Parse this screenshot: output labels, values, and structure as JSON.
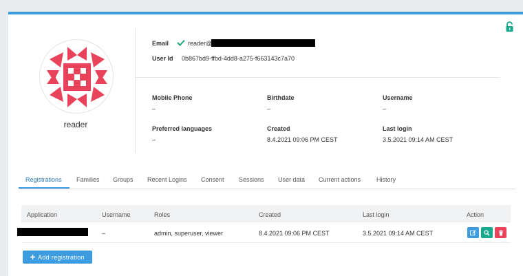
{
  "user": {
    "display_name": "reader",
    "email_label": "Email",
    "email_value": "reader@",
    "user_id_label": "User Id",
    "user_id_value": "0b867bd9-ffbd-4dd8-a275-f663143c7a70"
  },
  "details": [
    {
      "label": "Mobile Phone",
      "value": "–"
    },
    {
      "label": "Birthdate",
      "value": "–"
    },
    {
      "label": "Username",
      "value": "–"
    },
    {
      "label": "Preferred languages",
      "value": "–"
    },
    {
      "label": "Created",
      "value": "8.4.2021 09:06 PM CEST"
    },
    {
      "label": "Last login",
      "value": "3.5.2021 09:14 AM CEST"
    }
  ],
  "tabs": [
    "Registrations",
    "Families",
    "Groups",
    "Recent Logins",
    "Consent",
    "Sessions",
    "User data",
    "Current actions",
    "History"
  ],
  "active_tab": "Registrations",
  "table": {
    "headers": [
      "Application",
      "Username",
      "Roles",
      "Created",
      "Last login",
      "Action"
    ],
    "rows": [
      {
        "application": "",
        "username": "–",
        "roles": "admin, superuser, viewer",
        "created": "8.4.2021 09:06 PM CEST",
        "last_login": "3.5.2021 09:14 AM CEST"
      }
    ]
  },
  "add_registration_label": "Add registration",
  "icons": {
    "lock": "unlock-icon",
    "verified": "check-icon",
    "edit": "edit-icon",
    "view": "search-icon",
    "delete": "trash-icon",
    "add": "plus-icon"
  },
  "colors": {
    "accent": "#3d9be0",
    "success": "#1fa67a",
    "teal": "#1aaa8e",
    "danger": "#e8435a",
    "avatar": "#e8435a"
  }
}
